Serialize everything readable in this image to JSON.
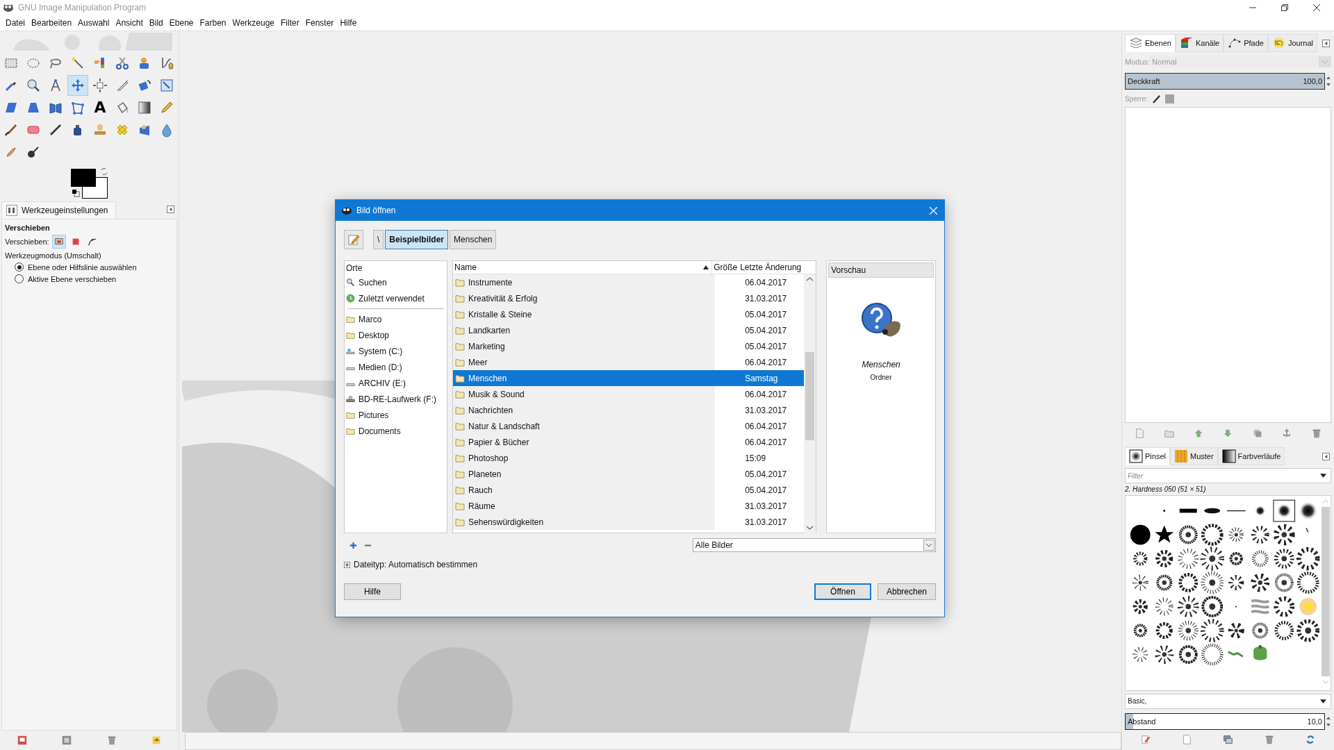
{
  "window": {
    "title": "GNU Image Manipulation Program"
  },
  "menu": [
    "Datei",
    "Bearbeiten",
    "Auswahl",
    "Ansicht",
    "Bild",
    "Ebene",
    "Farben",
    "Werkzeuge",
    "Filter",
    "Fenster",
    "Hilfe"
  ],
  "tools": [
    {
      "kind": "rectangle",
      "selected": false
    },
    {
      "kind": "ellipse",
      "selected": false
    },
    {
      "kind": "lasso",
      "selected": false
    },
    {
      "kind": "wand",
      "selected": false
    },
    {
      "kind": "colorselect",
      "selected": false
    },
    {
      "kind": "scissors",
      "selected": false
    },
    {
      "kind": "foreground",
      "selected": false
    },
    {
      "kind": "paths",
      "selected": false
    },
    {
      "kind": "picker",
      "selected": false
    },
    {
      "kind": "zoom",
      "selected": false
    },
    {
      "kind": "measure",
      "selected": false
    },
    {
      "kind": "move",
      "selected": true
    },
    {
      "kind": "align",
      "selected": false
    },
    {
      "kind": "crop",
      "selected": false
    },
    {
      "kind": "rotate",
      "selected": false
    },
    {
      "kind": "scale",
      "selected": false
    },
    {
      "kind": "shear",
      "selected": false
    },
    {
      "kind": "perspective",
      "selected": false
    },
    {
      "kind": "flip",
      "selected": false
    },
    {
      "kind": "cage",
      "selected": false
    },
    {
      "kind": "text",
      "glyph": "A",
      "selected": false
    },
    {
      "kind": "bucket",
      "selected": false
    },
    {
      "kind": "gradient",
      "selected": false
    },
    {
      "kind": "pencil",
      "selected": false
    },
    {
      "kind": "brush",
      "selected": false
    },
    {
      "kind": "eraser",
      "selected": false
    },
    {
      "kind": "airbrush",
      "selected": false
    },
    {
      "kind": "ink",
      "selected": false
    },
    {
      "kind": "clone",
      "selected": false
    },
    {
      "kind": "heal",
      "selected": false
    },
    {
      "kind": "perspectiveclone",
      "selected": false
    },
    {
      "kind": "blur",
      "selected": false
    },
    {
      "kind": "smudge",
      "selected": false
    },
    {
      "kind": "dodge",
      "selected": false
    }
  ],
  "tool_options": {
    "tab": "Werkzeugeinstellungen",
    "title": "Verschieben",
    "move_label": "Verschieben:",
    "move_targets": [
      {
        "kind": "layer",
        "selected": true
      },
      {
        "kind": "selection",
        "selected": false
      },
      {
        "kind": "path",
        "selected": false
      }
    ],
    "mode_label": "Werkzeugmodus (Umschalt)",
    "modes": [
      {
        "label": "Ebene oder Hilfslinie auswählen",
        "selected": true
      },
      {
        "label": "Aktive Ebene verschieben",
        "selected": false
      }
    ]
  },
  "dialog": {
    "title": "Bild öffnen",
    "path": [
      {
        "label": "\\",
        "selected": false
      },
      {
        "label": "Beispielbilder",
        "selected": true
      },
      {
        "label": "Menschen",
        "selected": false
      }
    ],
    "places_header": "Orte",
    "place_groups": [
      {
        "items": [
          {
            "kind": "search",
            "label": "Suchen"
          },
          {
            "kind": "recent",
            "label": "Zuletzt verwendet"
          }
        ]
      },
      {
        "items": [
          {
            "kind": "folder",
            "label": "Marco"
          },
          {
            "kind": "folder",
            "label": "Desktop"
          },
          {
            "kind": "system",
            "label": "System (C:)"
          },
          {
            "kind": "drive",
            "label": "Medien (D:)"
          },
          {
            "kind": "drive",
            "label": "ARCHIV (E:)"
          },
          {
            "kind": "optical",
            "label": "BD-RE-Laufwerk (F:)"
          },
          {
            "kind": "folder",
            "label": "Pictures"
          },
          {
            "kind": "folder",
            "label": "Documents"
          }
        ]
      }
    ],
    "columns": [
      "Name",
      "Größe",
      "Letzte Änderung"
    ],
    "files": [
      {
        "name": "Instrumente",
        "modified": "06.04.2017",
        "selected": false
      },
      {
        "name": "Kreativität & Erfolg",
        "modified": "31.03.2017",
        "selected": false
      },
      {
        "name": "Kristalle & Steine",
        "modified": "05.04.2017",
        "selected": false
      },
      {
        "name": "Landkarten",
        "modified": "05.04.2017",
        "selected": false
      },
      {
        "name": "Marketing",
        "modified": "05.04.2017",
        "selected": false
      },
      {
        "name": "Meer",
        "modified": "06.04.2017",
        "selected": false
      },
      {
        "name": "Menschen",
        "modified": "Samstag",
        "selected": true
      },
      {
        "name": "Musik & Sound",
        "modified": "06.04.2017",
        "selected": false
      },
      {
        "name": "Nachrichten",
        "modified": "31.03.2017",
        "selected": false
      },
      {
        "name": "Natur & Landschaft",
        "modified": "06.04.2017",
        "selected": false
      },
      {
        "name": "Papier & Bücher",
        "modified": "06.04.2017",
        "selected": false
      },
      {
        "name": "Photoshop",
        "modified": "15:09",
        "selected": false
      },
      {
        "name": "Planeten",
        "modified": "05.04.2017",
        "selected": false
      },
      {
        "name": "Rauch",
        "modified": "05.04.2017",
        "selected": false
      },
      {
        "name": "Räume",
        "modified": "31.03.2017",
        "selected": false
      },
      {
        "name": "Sehenswürdigkeiten",
        "modified": "31.03.2017",
        "selected": false
      }
    ],
    "preview": {
      "header": "Vorschau",
      "name": "Menschen",
      "type": "Ordner"
    },
    "filter": "Alle Bilder",
    "filetype": "Dateityp: Automatisch bestimmen",
    "buttons": [
      {
        "label": "Hilfe",
        "kind": "help"
      },
      {
        "label": "Öffnen",
        "kind": "default"
      },
      {
        "label": "Abbrechen",
        "kind": "cancel"
      }
    ]
  },
  "layers_dock": {
    "tabs": [
      {
        "label": "Ebenen",
        "kind": "layers",
        "selected": true
      },
      {
        "label": "Kanäle",
        "kind": "channels",
        "selected": false
      },
      {
        "label": "Pfade",
        "kind": "paths",
        "selected": false
      },
      {
        "label": "Journal",
        "kind": "history",
        "selected": false
      }
    ],
    "mode_label": "Modus:",
    "mode": "Normal",
    "opacity": {
      "label": "Deckkraft",
      "value": "100,0",
      "level": 1
    },
    "lock_label": "Sperre:"
  },
  "brushes_dock": {
    "tabs": [
      {
        "label": "Pinsel",
        "kind": "brushes",
        "selected": true
      },
      {
        "label": "Muster",
        "kind": "patterns",
        "selected": false
      },
      {
        "label": "Farbverläufe",
        "kind": "gradients",
        "selected": false
      }
    ],
    "filter": {
      "placeholder": "Filter"
    },
    "brush_name": "2. Hardness 050 (51 × 51)",
    "tag": "Basic,",
    "spacing": {
      "label": "Abstand",
      "value": "10,0",
      "level": 0.04
    }
  }
}
